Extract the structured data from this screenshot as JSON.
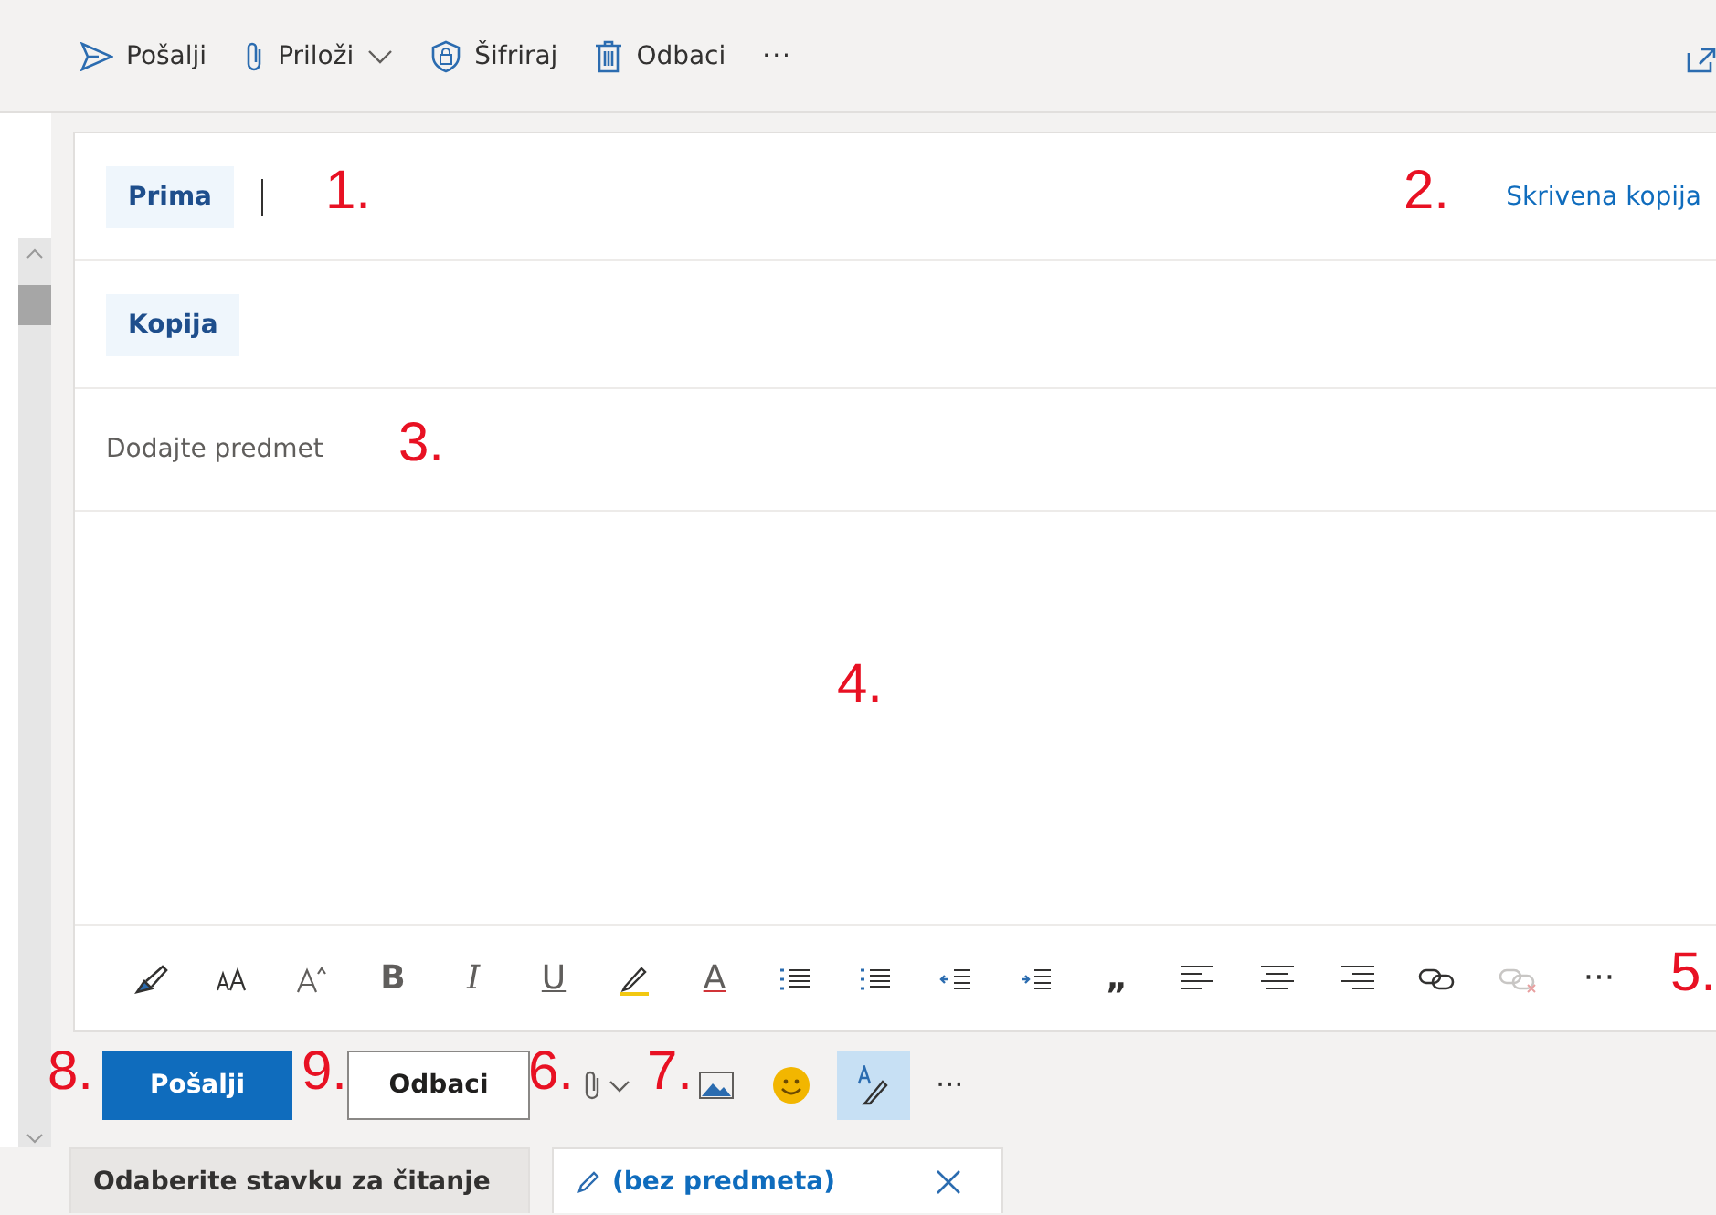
{
  "toolbar": [
    {
      "kind": "send",
      "label": "Pošalji"
    },
    {
      "kind": "attach",
      "label": "Priloži"
    },
    {
      "kind": "encrypt",
      "label": "Šifriraj"
    },
    {
      "kind": "discard",
      "label": "Odbaci"
    },
    {
      "kind": "more",
      "label": "···"
    }
  ],
  "to": {
    "label": "Prima"
  },
  "bcc": {
    "label": "Skrivena kopija"
  },
  "cc": {
    "label": "Kopija"
  },
  "subject": {
    "placeholder": "Dodajte predmet"
  },
  "format_tools": [
    {
      "kind": "painter"
    },
    {
      "kind": "size"
    },
    {
      "kind": "grow"
    },
    {
      "kind": "bold",
      "glyph": "B"
    },
    {
      "kind": "italic",
      "glyph": "I"
    },
    {
      "kind": "underline",
      "glyph": "U"
    },
    {
      "kind": "highlight"
    },
    {
      "kind": "fontcolor",
      "glyph": "A"
    },
    {
      "kind": "bullets"
    },
    {
      "kind": "numbers"
    },
    {
      "kind": "outdent"
    },
    {
      "kind": "indent"
    },
    {
      "kind": "quote",
      "glyph": "„"
    },
    {
      "kind": "left"
    },
    {
      "kind": "center"
    },
    {
      "kind": "right"
    },
    {
      "kind": "link"
    },
    {
      "kind": "unlink",
      "disabled": true
    },
    {
      "kind": "more",
      "glyph": "···"
    }
  ],
  "actions": {
    "send": "Pošalji",
    "discard": "Odbaci",
    "more": "···",
    "format_selected": true
  },
  "tabs": [
    {
      "label": "Odaberite stavku za čitanje",
      "selected": false
    },
    {
      "label": "(bez predmeta)",
      "selected": true,
      "closable": true
    }
  ],
  "annotations": [
    "1.",
    "2.",
    "3.",
    "4.",
    "5.",
    "8.",
    "9.",
    "6.",
    "7."
  ]
}
